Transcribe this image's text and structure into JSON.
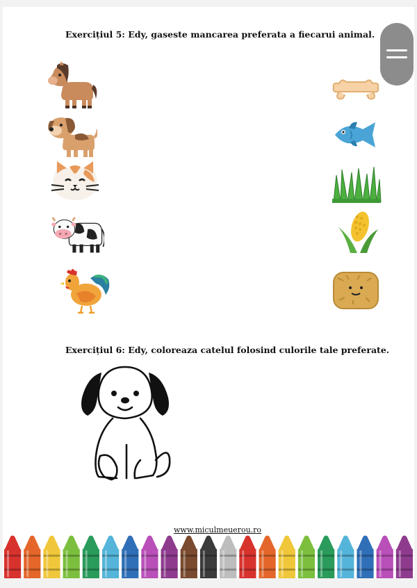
{
  "exercise5": {
    "title": "Exercițiul 5: Edy, gaseste mancarea preferata a fiecarui animal.",
    "animals": [
      "horse-icon",
      "dog-icon",
      "cat-icon",
      "cow-icon",
      "rooster-icon"
    ],
    "foods": [
      "bone-icon",
      "fish-icon",
      "grass-icon",
      "corn-icon",
      "hay-icon"
    ]
  },
  "exercise6": {
    "title": "Exercițiul 6: Edy, coloreaza catelul folosind culorile tale preferate."
  },
  "footer": {
    "link": "www.miculmeuerou.ro"
  },
  "crayon_colors": [
    "#d8322d",
    "#e4662a",
    "#f0c73a",
    "#7cbf3e",
    "#2a9b5b",
    "#54b4d9",
    "#2f6fb7",
    "#b94fb8",
    "#8e3b8e",
    "#7a4a2e",
    "#3b3b3b",
    "#bdbdbd",
    "#d8322d",
    "#e4662a",
    "#f0c73a",
    "#7cbf3e",
    "#2a9b5b",
    "#54b4d9",
    "#2f6fb7",
    "#b94fb8",
    "#8e3b8e"
  ]
}
